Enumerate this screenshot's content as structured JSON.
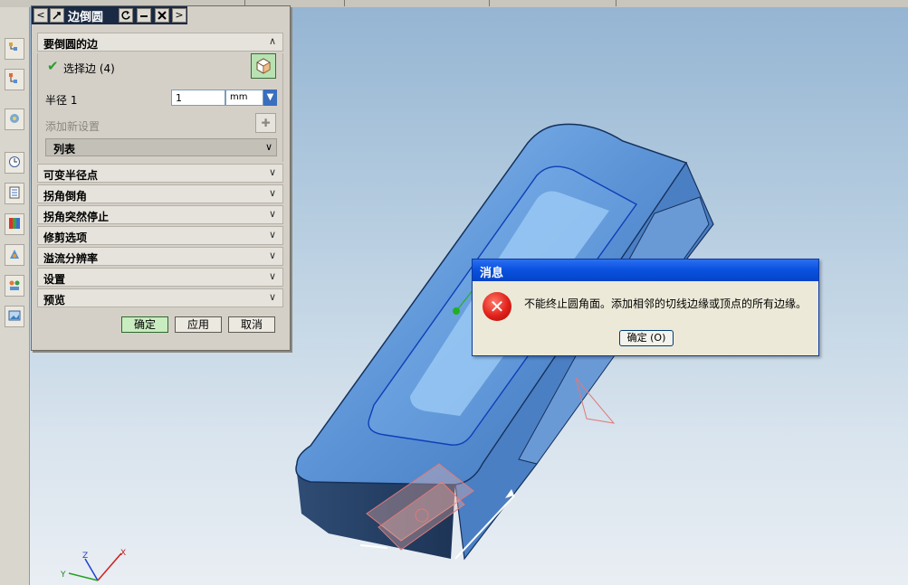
{
  "dialog": {
    "title": "边倒圆",
    "sections": {
      "edges_to_fillet": "要倒圆的边",
      "variable_radius_points": "可变半径点",
      "corner_setback": "拐角倒角",
      "stop_short_of_corner": "拐角突然停止",
      "trim_options": "修剪选项",
      "overflow_resolution": "溢流分辨率",
      "settings": "设置",
      "preview": "预览"
    },
    "select_edge_label": "选择边 (4)",
    "radius_label": "半径 1",
    "radius_value": "1",
    "radius_unit": "mm",
    "add_new_set_label": "添加新设置",
    "list_label": "列表",
    "buttons": {
      "ok": "确定",
      "apply": "应用",
      "cancel": "取消"
    }
  },
  "message_dialog": {
    "title": "消息",
    "text": "不能终止圆角面。添加相邻的切线边缘或顶点的所有边缘。",
    "ok_button": "确定 (O)"
  },
  "triad": {
    "x_label": "X",
    "y_label": "Y",
    "z_label": "Z"
  },
  "icons": {
    "error": "error-x-icon",
    "check": "checkmark-icon",
    "select_edge": "cube-select-icon",
    "add_set": "add-set-icon",
    "unit_dropdown": "down-arrow-icon"
  },
  "colors": {
    "model_face": "#5b93d6",
    "panel_bg": "#d4d0c8",
    "message_title": "#0a52e0",
    "error_icon": "#e0201a"
  }
}
